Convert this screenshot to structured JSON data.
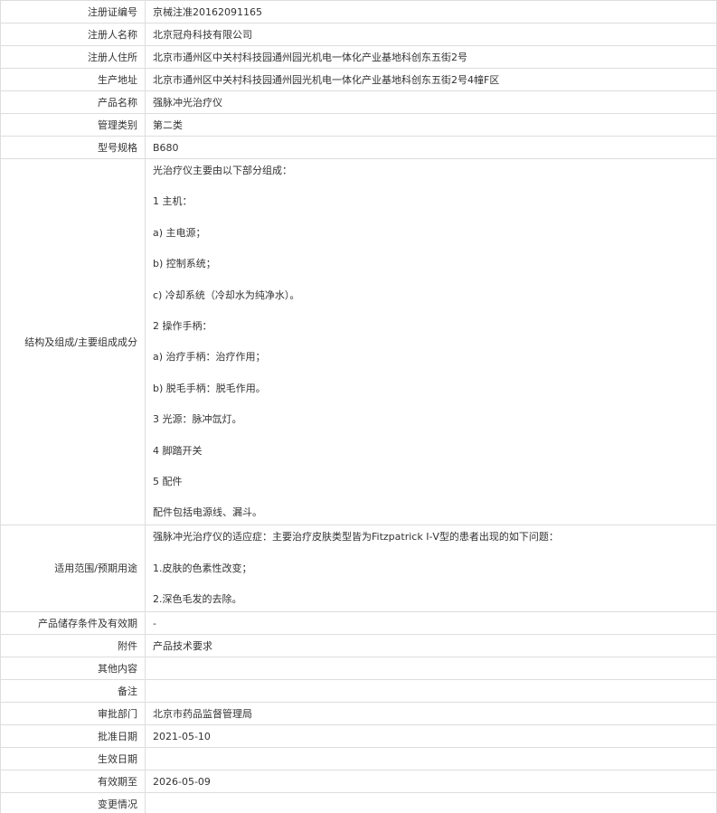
{
  "rows": {
    "reg_no": {
      "label": "注册证编号",
      "value": "京械注准20162091165"
    },
    "registrant": {
      "label": "注册人名称",
      "value": "北京冠舟科技有限公司"
    },
    "address": {
      "label": "注册人住所",
      "value": "北京市通州区中关村科技园通州园光机电一体化产业基地科创东五街2号"
    },
    "prod_addr": {
      "label": "生产地址",
      "value": "北京市通州区中关村科技园通州园光机电一体化产业基地科创东五街2号4幢F区"
    },
    "product": {
      "label": "产品名称",
      "value": "强脉冲光治疗仪"
    },
    "category": {
      "label": "管理类别",
      "value": "第二类"
    },
    "model": {
      "label": "型号规格",
      "value": "B680"
    },
    "structure": {
      "label": "结构及组成/主要组成成分",
      "lines": [
        "光治疗仪主要由以下部分组成：",
        "1 主机：",
        "a) 主电源；",
        "b) 控制系统；",
        "c) 冷却系统（冷却水为纯净水）。",
        "2 操作手柄：",
        "a) 治疗手柄：治疗作用；",
        "b) 脱毛手柄：脱毛作用。",
        "3 光源：脉冲氙灯。",
        "4 脚踏开关",
        "5 配件",
        "配件包括电源线、漏斗。"
      ]
    },
    "scope": {
      "label": "适用范围/预期用途",
      "lines": [
        "强脉冲光治疗仪的适应症：主要治疗皮肤类型皆为Fitzpatrick Ⅰ-Ⅴ型的患者出现的如下问题：",
        "1.皮肤的色素性改变；",
        "2.深色毛发的去除。"
      ]
    },
    "storage": {
      "label": "产品储存条件及有效期",
      "value": "-"
    },
    "attachment": {
      "label": "附件",
      "value": "产品技术要求"
    },
    "other": {
      "label": "其他内容",
      "value": ""
    },
    "remark": {
      "label": "备注",
      "value": ""
    },
    "authority": {
      "label": "审批部门",
      "value": "北京市药品监督管理局"
    },
    "approve_date": {
      "label": "批准日期",
      "value": "2021-05-10"
    },
    "effective": {
      "label": "生效日期",
      "value": ""
    },
    "valid_until": {
      "label": "有效期至",
      "value": "2026-05-09"
    },
    "change": {
      "label": "变更情况",
      "value": ""
    }
  }
}
